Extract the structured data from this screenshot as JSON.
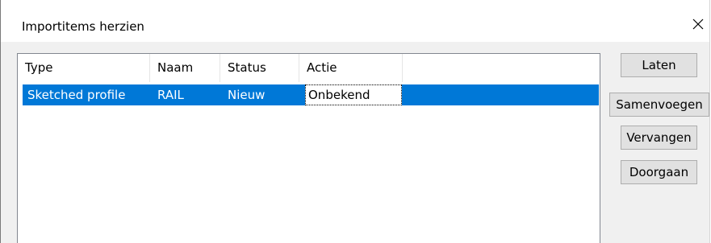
{
  "dialog": {
    "title": "Importitems herzien",
    "close_icon": "close-icon"
  },
  "list": {
    "columns": [
      "Type",
      "Naam",
      "Status",
      "Actie"
    ],
    "rows": [
      {
        "type": "Sketched profile",
        "naam": "RAIL",
        "status": "Nieuw",
        "actie": "Onbekend",
        "selected": true
      }
    ],
    "selection_color": "#0078d7"
  },
  "buttons": {
    "laten": "Laten",
    "samenvoegen": "Samenvoegen",
    "vervangen": "Vervangen",
    "doorgaan": "Doorgaan"
  }
}
